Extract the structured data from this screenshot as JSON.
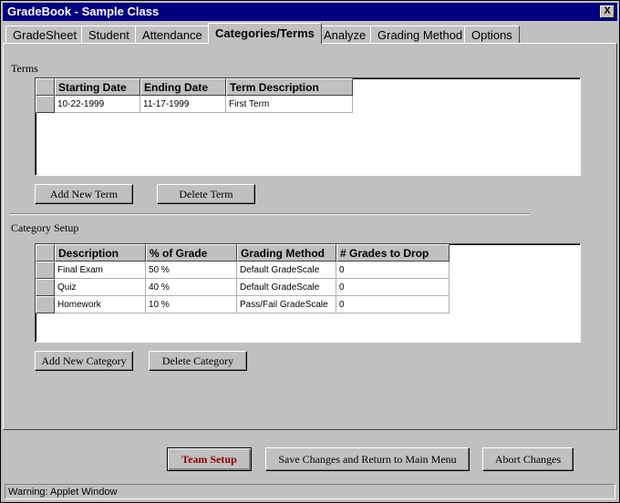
{
  "window": {
    "title": "GradeBook - Sample Class",
    "close_glyph": "X"
  },
  "tabs": [
    {
      "label": "GradeSheet"
    },
    {
      "label": "Student"
    },
    {
      "label": "Attendance"
    },
    {
      "label": "Categories/Terms",
      "active": true
    },
    {
      "label": "Analyze"
    },
    {
      "label": "Grading Method"
    },
    {
      "label": "Options"
    }
  ],
  "terms": {
    "label": "Terms",
    "columns": [
      "Starting Date",
      "Ending Date",
      "Term Description"
    ],
    "rows": [
      [
        "10-22-1999",
        "11-17-1999",
        "First Term"
      ]
    ],
    "add_button": "Add New Term",
    "delete_button": "Delete Term"
  },
  "categories": {
    "label": "Category Setup",
    "columns": [
      "Description",
      "% of Grade",
      "Grading Method",
      "# Grades to Drop"
    ],
    "rows": [
      [
        "Final Exam",
        "50 %",
        "Default GradeScale",
        "0"
      ],
      [
        "Quiz",
        "40 %",
        "Default GradeScale",
        "0"
      ],
      [
        "Homework",
        "10 %",
        "Pass/Fail GradeScale",
        "0"
      ]
    ],
    "add_button": "Add New Category",
    "delete_button": "Delete Category"
  },
  "footer": {
    "team_setup": "Team Setup",
    "save_return": "Save Changes and Return to Main Menu",
    "abort": "Abort Changes"
  },
  "status": "Warning: Applet Window",
  "colors": {
    "titlebar": "#000080",
    "team_setup_text": "#8b0000",
    "face": "#c0c0c0"
  }
}
